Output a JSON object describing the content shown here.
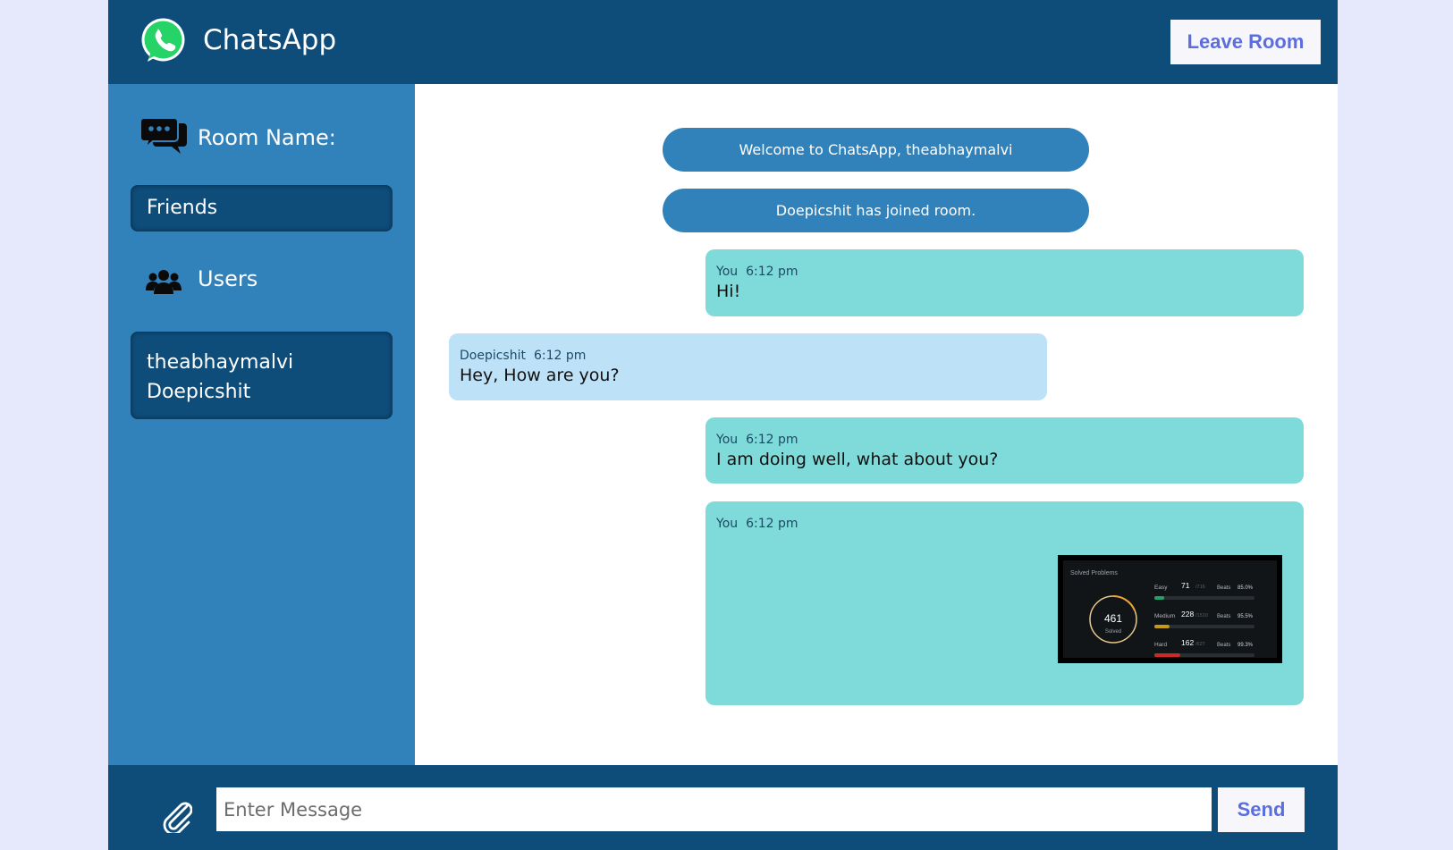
{
  "header": {
    "app_title": "ChatsApp",
    "leave_label": "Leave Room",
    "logo_icon": "whatsapp-logo-icon"
  },
  "sidebar": {
    "room_heading": "Room Name:",
    "room_name": "Friends",
    "users_heading": "Users",
    "users": [
      "theabhaymalvi",
      "Doepicshit"
    ],
    "room_icon": "chat-bubbles-icon",
    "users_icon": "users-group-icon"
  },
  "chat": {
    "notices": [
      "Welcome to ChatsApp, theabhaymalvi",
      "Doepicshit has joined room."
    ],
    "messages": [
      {
        "sender": "You",
        "time": "6:12 pm",
        "text": "Hi!",
        "mine": true
      },
      {
        "sender": "Doepicshit",
        "time": "6:12 pm",
        "text": "Hey, How are you?",
        "mine": false
      },
      {
        "sender": "You",
        "time": "6:12 pm",
        "text": "I am doing well, what about you?",
        "mine": true
      },
      {
        "sender": "You",
        "time": "6:12 pm",
        "text": "",
        "mine": true,
        "attachment": {
          "title": "Solved Problems",
          "solved_count": "461",
          "solved_label": "Solved",
          "rows": [
            {
              "label": "Easy",
              "count": "71",
              "total": "/716",
              "beats_label": "Beats",
              "beats": "85.0%",
              "color": "#1fa36b",
              "progress": 0.099
            },
            {
              "label": "Medium",
              "count": "228",
              "total": "/1510",
              "beats_label": "Beats",
              "beats": "95.5%",
              "color": "#c79a13",
              "progress": 0.151
            },
            {
              "label": "Hard",
              "count": "162",
              "total": "/627",
              "beats_label": "Beats",
              "beats": "99.3%",
              "color": "#c92b2b",
              "progress": 0.258
            }
          ]
        }
      }
    ]
  },
  "footer": {
    "input_placeholder": "Enter Message",
    "send_label": "Send",
    "attach_icon": "paperclip-icon"
  },
  "colors": {
    "header_bg": "#0e4c7a",
    "sidebar_bg": "#3182bb",
    "mine_bubble": "#7fdbd9",
    "theirs_bubble": "#bde2f8",
    "accent_button_text": "#5a6ee0"
  }
}
